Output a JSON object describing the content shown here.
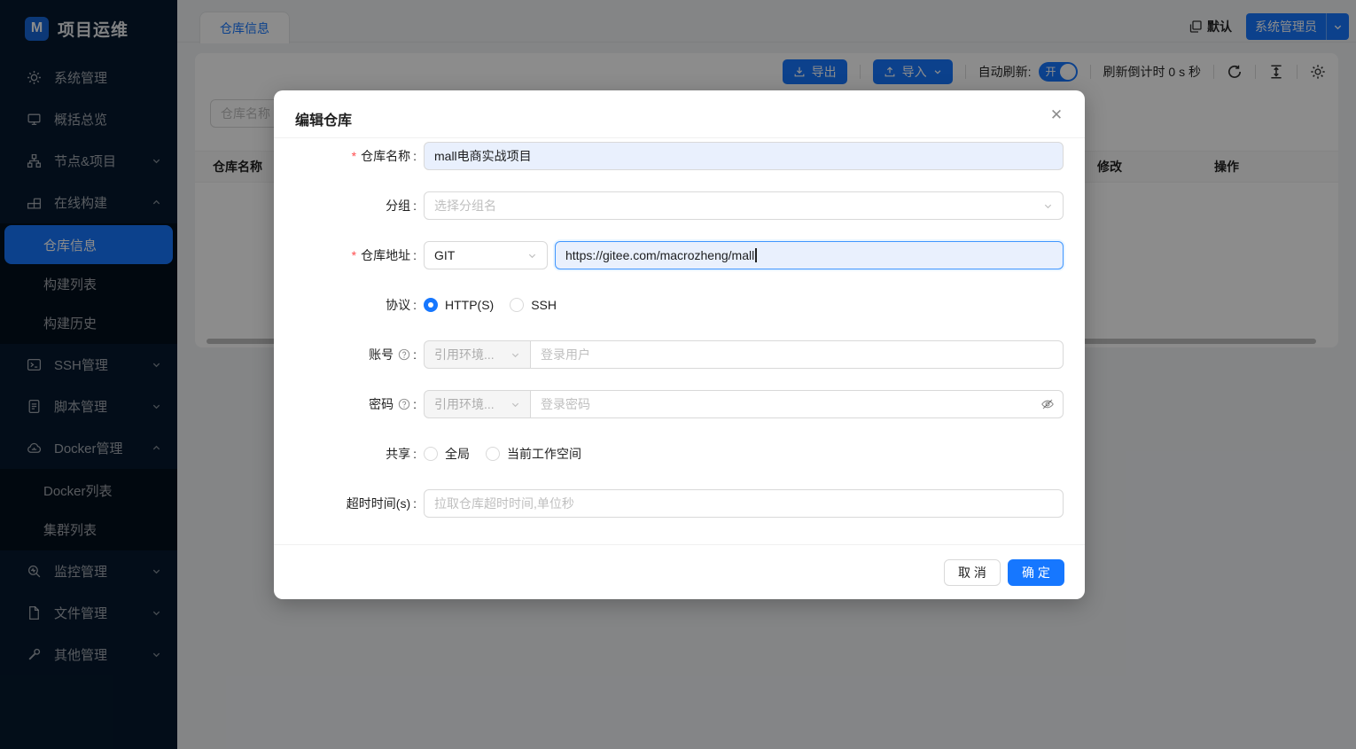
{
  "app": {
    "title": "项目运维"
  },
  "sidebar": {
    "items": [
      {
        "label": "系统管理",
        "icon": "gear-icon"
      },
      {
        "label": "概括总览",
        "icon": "monitor-icon"
      },
      {
        "label": "节点&项目",
        "icon": "cluster-icon",
        "chevron": "down"
      },
      {
        "label": "在线构建",
        "icon": "build-icon",
        "chevron": "up"
      },
      {
        "label": "SSH管理",
        "icon": "terminal-icon",
        "chevron": "down"
      },
      {
        "label": "脚本管理",
        "icon": "script-icon",
        "chevron": "down"
      },
      {
        "label": "Docker管理",
        "icon": "docker-icon",
        "chevron": "up"
      },
      {
        "label": "监控管理",
        "icon": "monitor-search-icon",
        "chevron": "down"
      },
      {
        "label": "文件管理",
        "icon": "file-icon",
        "chevron": "down"
      },
      {
        "label": "其他管理",
        "icon": "wrench-icon",
        "chevron": "down"
      }
    ],
    "build_children": [
      {
        "label": "仓库信息",
        "active": true
      },
      {
        "label": "构建列表",
        "active": false
      },
      {
        "label": "构建历史",
        "active": false
      }
    ],
    "docker_children": [
      {
        "label": "Docker列表",
        "active": false
      },
      {
        "label": "集群列表",
        "active": false
      }
    ]
  },
  "tabs": {
    "active_label": "仓库信息"
  },
  "topbar": {
    "workspace_label": "默认",
    "user_label": "系统管理员"
  },
  "toolbar": {
    "export_label": "导出",
    "import_label": "导入",
    "auto_refresh_label": "自动刷新:",
    "switch_label": "开",
    "countdown_label": "刷新倒计时 0 s 秒"
  },
  "content": {
    "search_placeholder": "仓库名称",
    "columns": [
      "仓库名称",
      "修改",
      "操作"
    ]
  },
  "modal": {
    "title": "编辑仓库",
    "close_glyph": "✕",
    "required_mark": "*",
    "colon": ":",
    "labels": {
      "name": "仓库名称",
      "group": "分组",
      "url": "仓库地址",
      "protocol": "协议",
      "account": "账号",
      "password": "密码",
      "share": "共享",
      "timeout": "超时时间(s)"
    },
    "name_value": "mall电商实战项目",
    "group_placeholder": "选择分组名",
    "repo_type_value": "GIT",
    "url_value": "https://gitee.com/macrozheng/mall",
    "protocol_options": [
      "HTTP(S)",
      "SSH"
    ],
    "protocol_selected": "HTTP(S)",
    "account_select_value": "引用环境...",
    "account_placeholder": "登录用户",
    "password_select_value": "引用环境...",
    "password_placeholder": "登录密码",
    "share_options": [
      "全局",
      "当前工作空间"
    ],
    "share_selected": "",
    "timeout_placeholder": "拉取仓库超时时间,单位秒",
    "cancel_label": "取 消",
    "ok_label": "确 定"
  },
  "colors": {
    "primary": "#1677ff",
    "focus_border": "#4096ff",
    "autofill_bg": "#e9f0fd",
    "sidebar_bg": "#06192e",
    "submenu_bg": "#020f1d",
    "required": "#ff4d4f",
    "mask": "rgba(0,0,0,0.45)"
  }
}
